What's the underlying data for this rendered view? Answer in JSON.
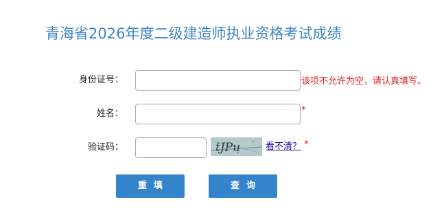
{
  "title": "青海省2026年度二级建造师执业资格考试成绩",
  "form": {
    "id_label": "身份证号：",
    "id_value": "",
    "id_error": "该项不允许为空，请认真填写。",
    "name_label": "姓名：",
    "name_value": "",
    "name_required": "*",
    "captcha_label": "验证码：",
    "captcha_value": "",
    "captcha_text": "tJPu",
    "refresh_link": "看不清？",
    "captcha_required": "*"
  },
  "buttons": {
    "reset": "重填",
    "query": "查询"
  },
  "colors": {
    "title": "#3f86c7",
    "button": "#3484cc",
    "error": "#e02020",
    "link": "#1a0dab"
  }
}
